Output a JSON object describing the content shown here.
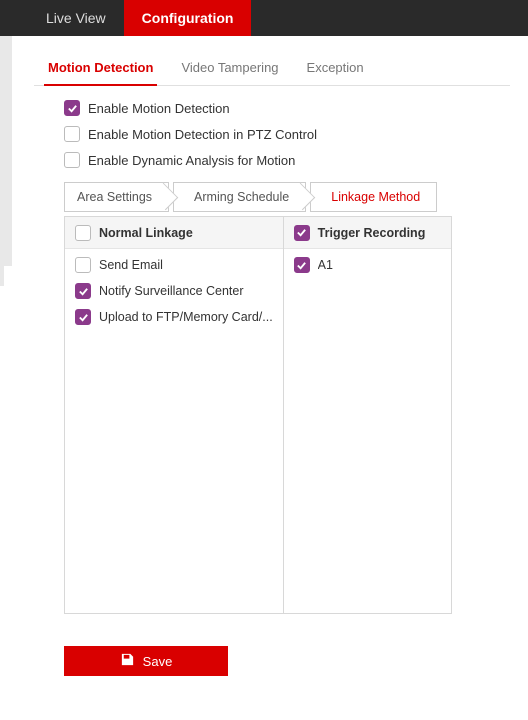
{
  "accent": "#d90000",
  "checkbox_color": "#8b3a8b",
  "topbar": {
    "tabs": [
      {
        "label": "Live View",
        "active": false
      },
      {
        "label": "Configuration",
        "active": true
      }
    ]
  },
  "subtabs": [
    {
      "label": "Motion Detection",
      "active": true
    },
    {
      "label": "Video Tampering",
      "active": false
    },
    {
      "label": "Exception",
      "active": false
    }
  ],
  "enable_checks": [
    {
      "label": "Enable Motion Detection",
      "checked": true
    },
    {
      "label": "Enable Motion Detection in PTZ Control",
      "checked": false
    },
    {
      "label": "Enable Dynamic Analysis for Motion",
      "checked": false
    }
  ],
  "step_tabs": [
    {
      "label": "Area Settings",
      "active": false
    },
    {
      "label": "Arming Schedule",
      "active": false
    },
    {
      "label": "Linkage Method",
      "active": true
    }
  ],
  "linkage": {
    "columns": [
      {
        "header": "Normal Linkage",
        "header_checked": false,
        "items": [
          {
            "label": "Send Email",
            "checked": false
          },
          {
            "label": "Notify Surveillance Center",
            "checked": true
          },
          {
            "label": "Upload to FTP/Memory Card/...",
            "checked": true
          }
        ]
      },
      {
        "header": "Trigger Recording",
        "header_checked": true,
        "items": [
          {
            "label": "A1",
            "checked": true
          }
        ]
      }
    ]
  },
  "buttons": {
    "save": "Save"
  }
}
